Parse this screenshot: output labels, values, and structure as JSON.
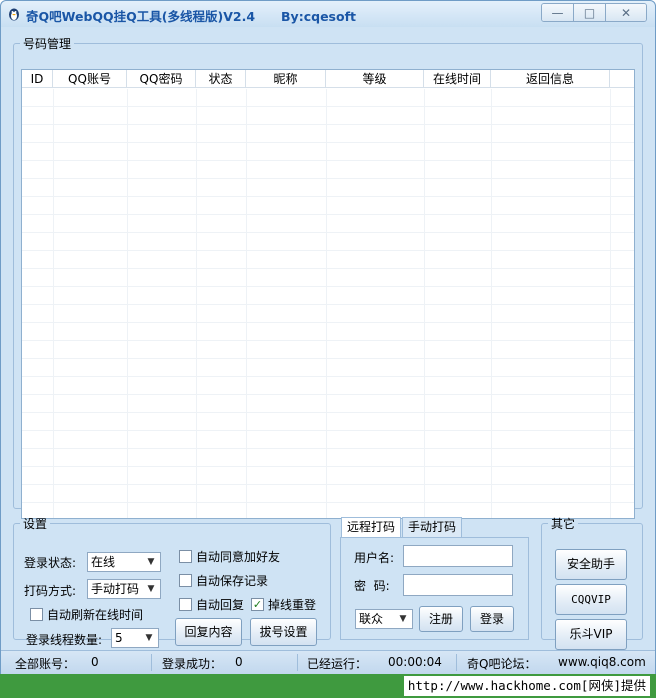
{
  "window": {
    "title": "奇Q吧WebQQ挂Q工具(多线程版)V2.4",
    "author": "By:cqesoft"
  },
  "account_panel": {
    "legend": "号码管理",
    "columns": [
      "ID",
      "QQ账号",
      "QQ密码",
      "状态",
      "昵称",
      "等级",
      "在线时间",
      "返回信息"
    ]
  },
  "settings": {
    "legend": "设置",
    "login_status_label": "登录状态:",
    "login_status_value": "在线",
    "captcha_mode_label": "打码方式:",
    "captcha_mode_value": "手动打码",
    "auto_refresh_label": "自动刷新在线时间",
    "thread_count_label": "登录线程数量:",
    "thread_count_value": "5",
    "auto_accept_friend_label": "自动同意加好友",
    "auto_save_log_label": "自动保存记录",
    "auto_reply_label": "自动回复",
    "reconnect_label": "掉线重登",
    "reply_content_button": "回复内容",
    "dial_settings_button": "拔号设置"
  },
  "captcha_panel": {
    "tabs": [
      "远程打码",
      "手动打码"
    ],
    "username_label": "用户名:",
    "password_label": "密  码:",
    "provider_value": "联众",
    "register_button": "注册",
    "login_button": "登录"
  },
  "other": {
    "legend": "其它",
    "buttons": [
      "安全助手",
      "CQQVIP",
      "乐斗VIP"
    ]
  },
  "statusbar": {
    "total_label": "全部账号：",
    "total_value": "0",
    "success_label": "登录成功：",
    "success_value": "0",
    "runtime_label": "已经运行：",
    "runtime_value": "00:00:04",
    "forum_label": "奇Q吧论坛：",
    "forum_value": "www.qiq8.com"
  },
  "watermark": "http://www.hackhome.com[网侠]提供"
}
